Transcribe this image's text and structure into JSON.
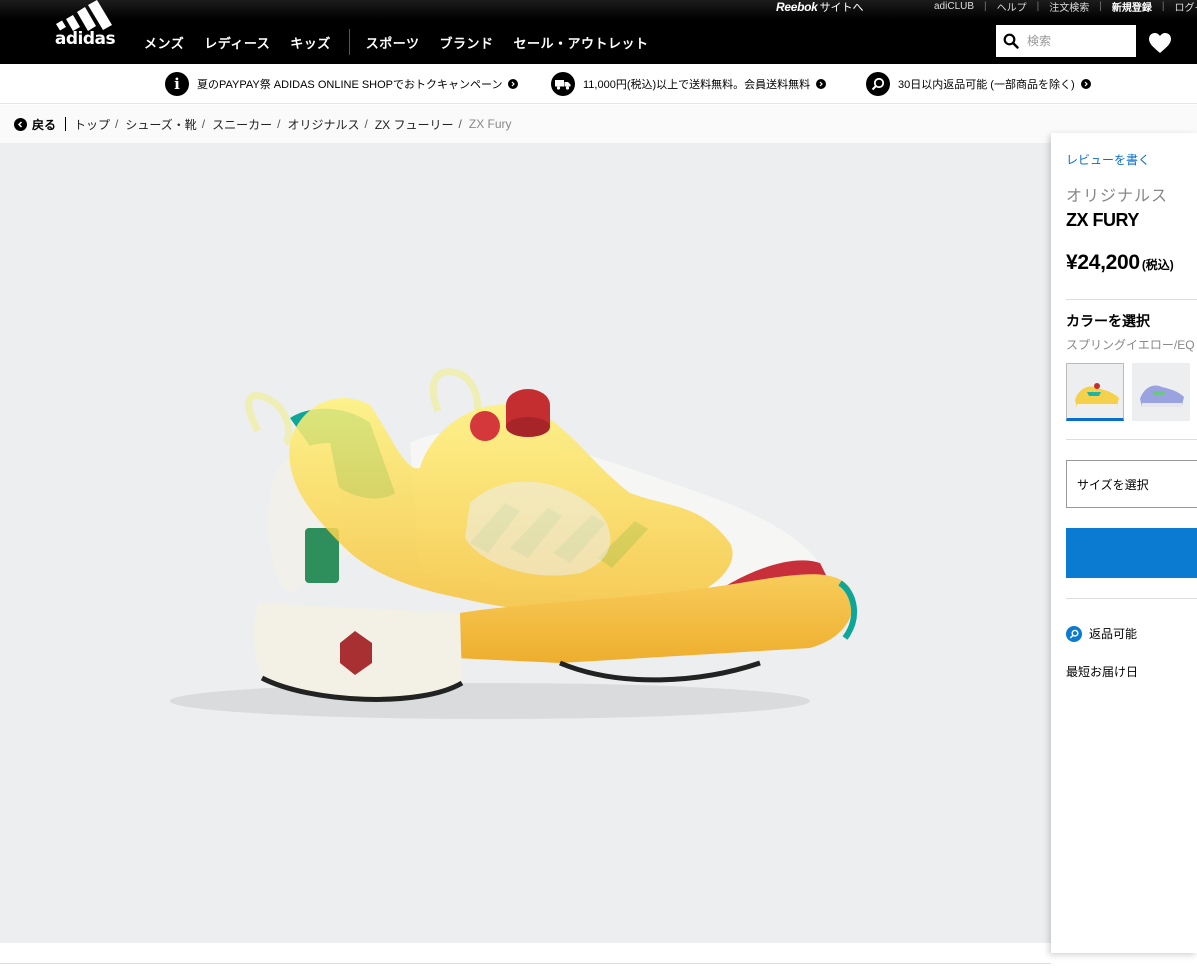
{
  "utility_bar": {
    "reebok_logo": "Reebok",
    "reebok_site": "サイトへ",
    "links": [
      "adiCLUB",
      "ヘルプ",
      "注文検索"
    ],
    "register": "新規登録",
    "login": "ログイン"
  },
  "nav": {
    "logo": "adidas",
    "items": [
      "メンズ",
      "レディース",
      "キッズ"
    ],
    "items2": [
      "スポーツ",
      "ブランド",
      "セール・アウトレット"
    ],
    "search_placeholder": "検索"
  },
  "promos": [
    {
      "icon": "info-icon",
      "text": "夏のPAYPAY祭 ADIDAS ONLINE SHOPでおトクキャンペーン"
    },
    {
      "icon": "truck-icon",
      "text": "11,000円(税込)以上で送料無料。会員送料無料"
    },
    {
      "icon": "return-icon",
      "text": "30日以内返品可能 (一部商品を除く)"
    }
  ],
  "breadcrumb": {
    "back": "戻る",
    "items": [
      "トップ",
      "シューズ・靴",
      "スニーカー",
      "オリジナルス",
      "ZX フューリー"
    ],
    "current": "ZX Fury"
  },
  "product": {
    "review_link": "レビューを書く",
    "category": "オリジナルス",
    "name": "ZX FURY",
    "price": "¥24,200",
    "tax_note": "(税込)",
    "color_title": "カラーを選択",
    "color_name": "スプリングイエロー/EQ",
    "size_select": "サイズを選択",
    "returns": "返品可能",
    "delivery": "最短お届け日"
  },
  "colors": {
    "accent_blue": "#0a7bd1",
    "nav_bg": "#000000",
    "gallery_bg": "#eceef0"
  }
}
